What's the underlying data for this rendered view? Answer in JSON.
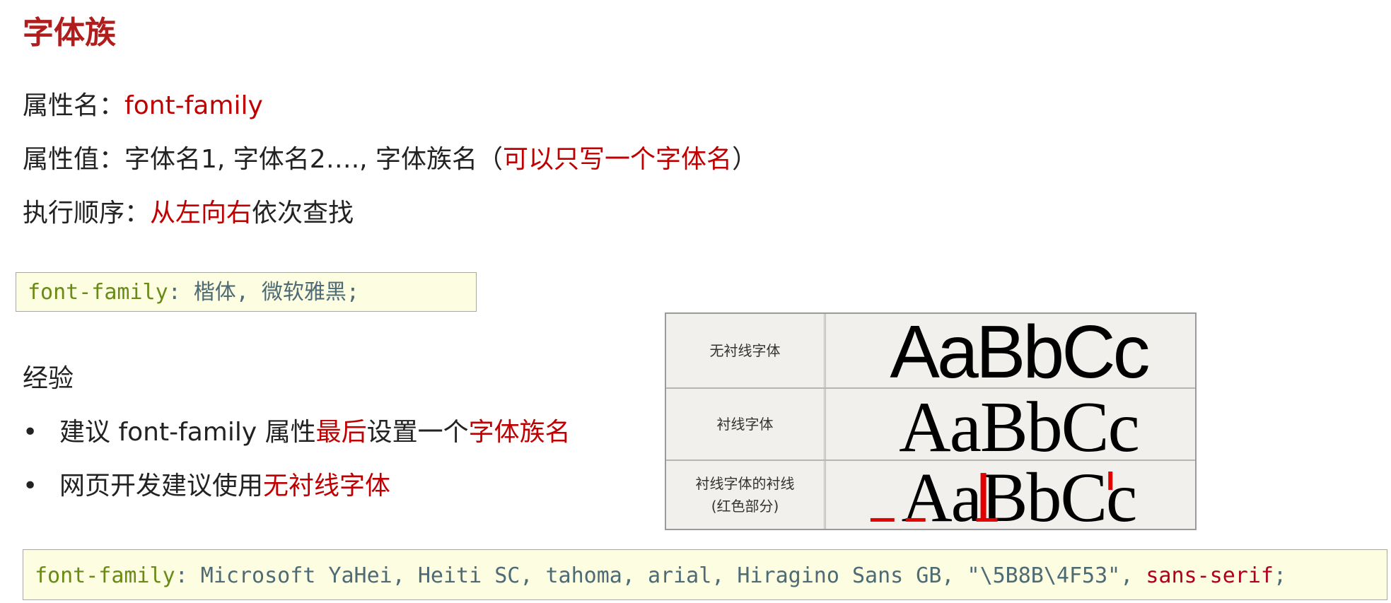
{
  "title": "字体族",
  "prop_name": {
    "label": "属性名：",
    "value": "font-family"
  },
  "prop_value": {
    "label": "属性值：",
    "text": "字体名1, 字体名2…., 字体族名（",
    "highlight": "可以只写一个字体名",
    "close": "）"
  },
  "exec_order": {
    "label": "执行顺序：",
    "highlight": "从左向右",
    "rest": "依次查找"
  },
  "code1": {
    "property": "font-family",
    "value": ": 楷体, 微软雅黑;"
  },
  "experience": {
    "heading": "经验",
    "bullet_symbol": "•",
    "items": [
      {
        "pre": "建议 font-family 属性",
        "hl1": "最后",
        "mid": "设置一个",
        "hl2": "字体族名"
      },
      {
        "pre": "网页开发建议使用",
        "hl1": "无衬线字体"
      }
    ]
  },
  "table": {
    "sample_text": "AaBbCc",
    "rows": [
      {
        "label": "无衬线字体"
      },
      {
        "label": "衬线字体"
      },
      {
        "label": "衬线字体的衬线",
        "label2": "(红色部分)"
      }
    ]
  },
  "code2": {
    "property": "font-family",
    "value": ": Microsoft YaHei, Heiti SC, tahoma, arial, Hiragino Sans GB, \"\\5B8B\\4F53\",",
    "highlight": "sans-serif",
    "end": ";"
  },
  "colors": {
    "title": "#b01d1d",
    "highlight": "#c00000",
    "code_bg": "#fdfde1",
    "code_property": "#6a8a16",
    "code_value": "#4d6b75",
    "serif_marker": "#e00000"
  }
}
